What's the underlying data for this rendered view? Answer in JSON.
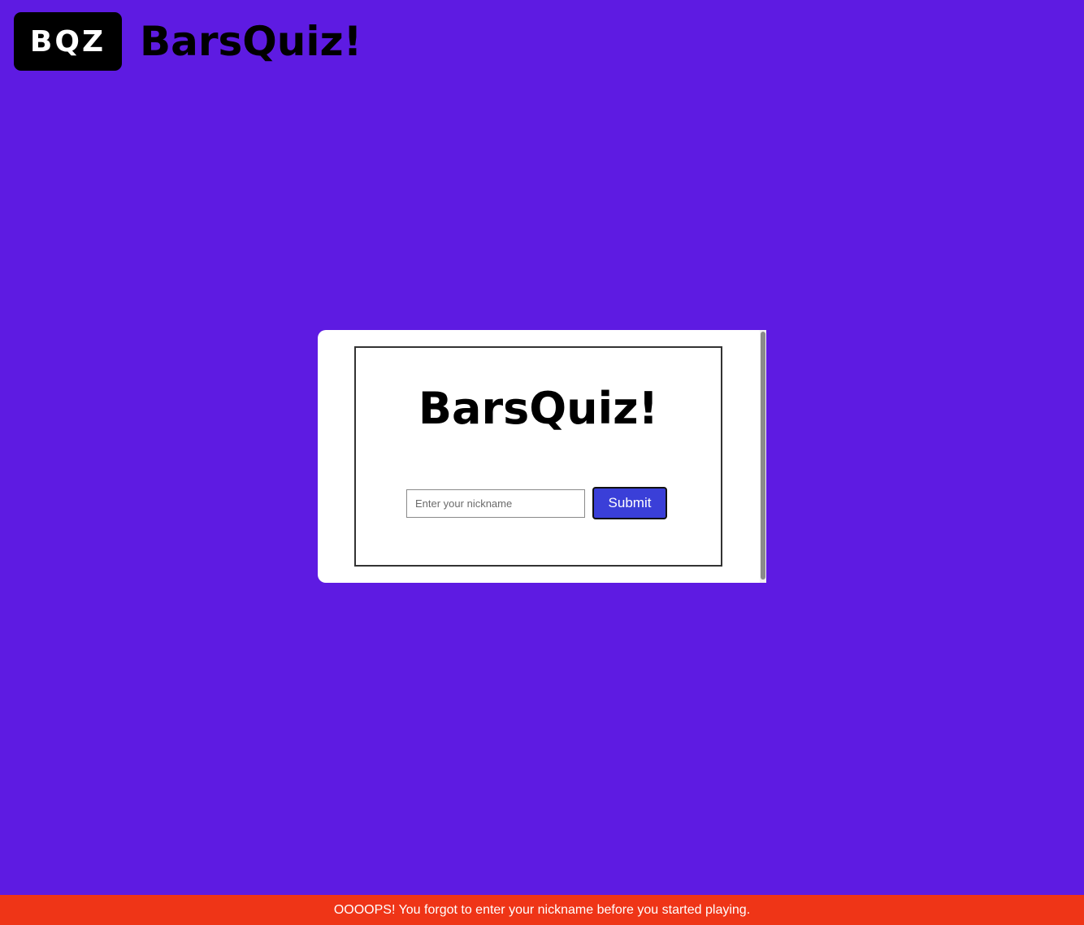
{
  "header": {
    "badge_text": "BQZ",
    "wordmark": "BarsQuiz!"
  },
  "card": {
    "wordmark": "BarsQuiz!",
    "nickname_input": {
      "value": "",
      "placeholder": "Enter your nickname"
    },
    "submit_label": "Submit"
  },
  "error": {
    "message": "OOOOPS! You forgot to enter your nickname before you started playing."
  },
  "colors": {
    "background": "#5e1be2",
    "button": "#3a3fd8",
    "error_banner": "#ef3517"
  }
}
